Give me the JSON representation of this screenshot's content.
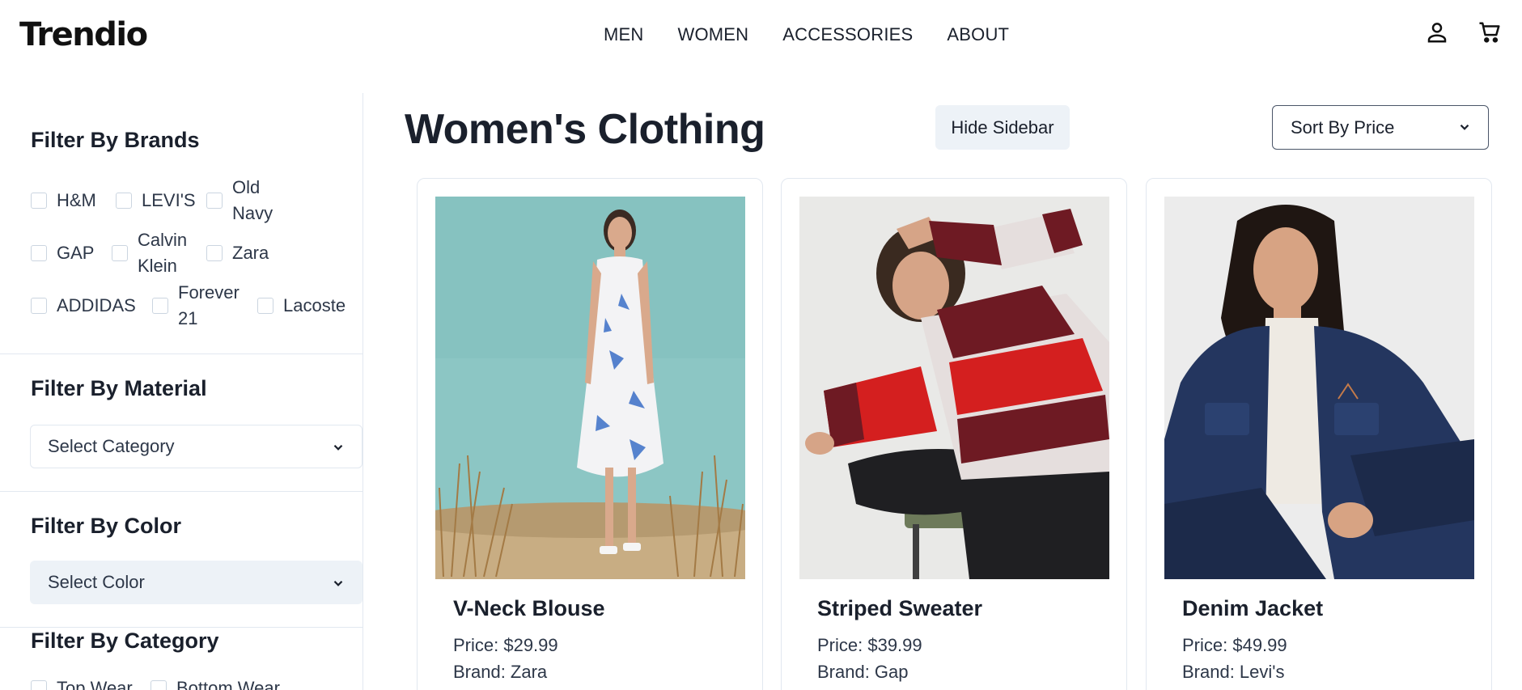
{
  "header": {
    "logo": "Trendio",
    "nav": [
      "MEN",
      "WOMEN",
      "ACCESSORIES",
      "ABOUT"
    ],
    "icons": [
      "user-icon",
      "cart-icon"
    ]
  },
  "sidebar": {
    "brands": {
      "title": "Filter By Brands",
      "items": [
        "H&M",
        "LEVI'S",
        "Old Navy",
        "GAP",
        "Calvin Klein",
        "Zara",
        "ADDIDAS",
        "Forever 21",
        "Lacoste"
      ]
    },
    "material": {
      "title": "Filter By Material",
      "select": "Select Category"
    },
    "color": {
      "title": "Filter By Color",
      "select": "Select Color"
    },
    "category": {
      "title": "Filter By Category",
      "items": [
        "Top Wear",
        "Bottom Wear"
      ]
    }
  },
  "main": {
    "title": "Women's Clothing",
    "hide_sidebar": "Hide Sidebar",
    "sort": "Sort By Price",
    "products": [
      {
        "name": "V-Neck Blouse",
        "price": "Price: $29.99",
        "brand": "Brand: Zara"
      },
      {
        "name": "Striped Sweater",
        "price": "Price: $39.99",
        "brand": "Brand: Gap"
      },
      {
        "name": "Denim Jacket",
        "price": "Price: $49.99",
        "brand": "Brand: Levi's"
      }
    ]
  },
  "colors": {
    "text": "#1a202c",
    "border": "#e2e8f0",
    "button_bg": "#edf2f7"
  }
}
